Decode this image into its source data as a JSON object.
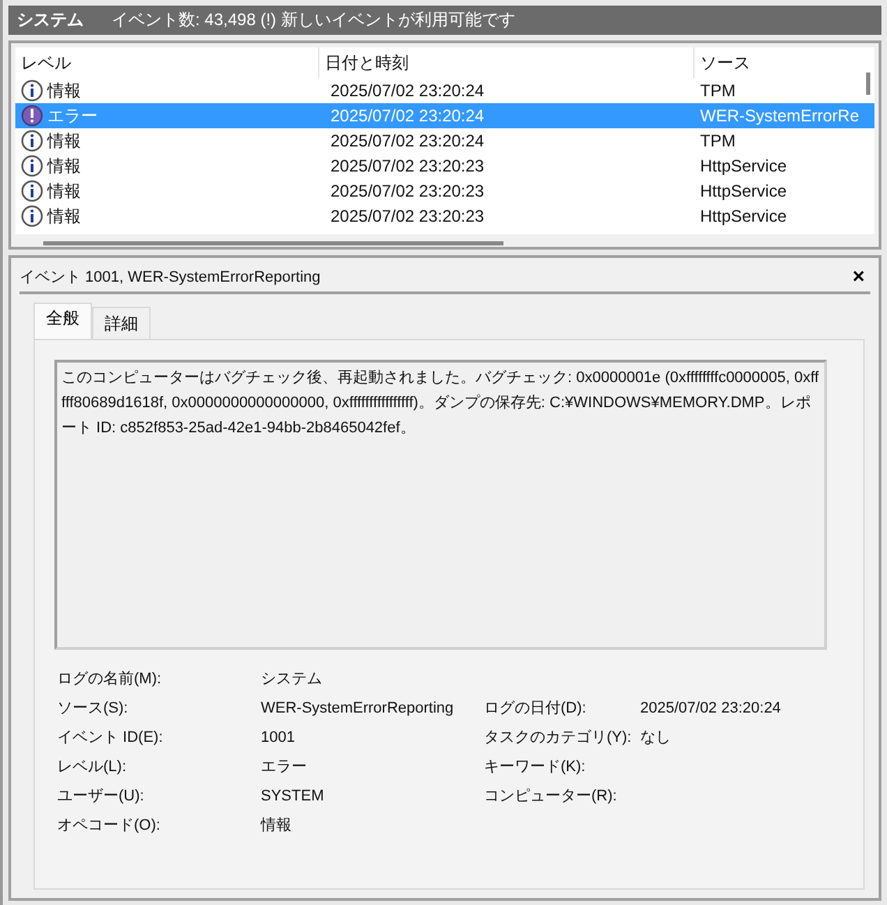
{
  "header": {
    "title": "システム",
    "info": "イベント数: 43,498 (!) 新しいイベントが利用可能です"
  },
  "table": {
    "columns": [
      "レベル",
      "日付と時刻",
      "ソース"
    ],
    "rows": [
      {
        "kind": "info",
        "level": "情報",
        "date": "2025/07/02 23:20:24",
        "source": "TPM",
        "selected": false
      },
      {
        "kind": "error",
        "level": "エラー",
        "date": "2025/07/02 23:20:24",
        "source": "WER-SystemErrorRe",
        "selected": true
      },
      {
        "kind": "info",
        "level": "情報",
        "date": "2025/07/02 23:20:24",
        "source": "TPM",
        "selected": false
      },
      {
        "kind": "info",
        "level": "情報",
        "date": "2025/07/02 23:20:23",
        "source": "HttpService",
        "selected": false
      },
      {
        "kind": "info",
        "level": "情報",
        "date": "2025/07/02 23:20:23",
        "source": "HttpService",
        "selected": false
      },
      {
        "kind": "info",
        "level": "情報",
        "date": "2025/07/02 23:20:23",
        "source": "HttpService",
        "selected": false
      }
    ]
  },
  "detail": {
    "title": "イベント 1001, WER-SystemErrorReporting",
    "close": "×",
    "tabs": [
      {
        "label": "全般",
        "selected": true
      },
      {
        "label": "詳細",
        "selected": false
      }
    ],
    "message": "このコンピューターはバグチェック後、再起動されました。バグチェック: 0x0000001e (0xffffffffc0000005, 0xfffff80689d1618f, 0x0000000000000000, 0xffffffffffffffff)。ダンプの保存先: C:¥WINDOWS¥MEMORY.DMP。レポート ID: c852f853-25ad-42e1-94bb-2b8465042fef。",
    "properties": [
      {
        "label": "ログの名前(M):",
        "value": "システム"
      },
      {
        "label": "ソース(S):",
        "value": "WER-SystemErrorReporting",
        "label_2": "ログの日付(D):",
        "value_2": "2025/07/02 23:20:24"
      },
      {
        "label": "イベント ID(E):",
        "value": "1001",
        "label_2": "タスクのカテゴリ(Y):",
        "value_2": "なし"
      },
      {
        "label": "レベル(L):",
        "value": "エラー",
        "label_2": "キーワード(K):"
      },
      {
        "label": "ユーザー(U):",
        "value": "SYSTEM",
        "label_2": "コンピューター(R):"
      },
      {
        "label": "オペコード(O):",
        "value": "情報"
      }
    ]
  }
}
